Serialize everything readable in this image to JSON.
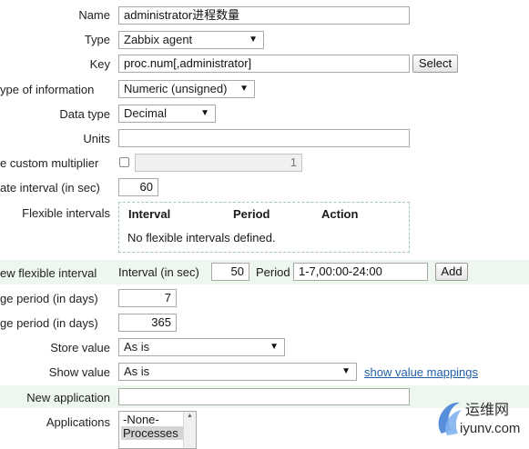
{
  "form": {
    "name": {
      "label": "Name",
      "value": "administrator进程数量"
    },
    "type": {
      "label": "Type",
      "value": "Zabbix agent"
    },
    "key": {
      "label": "Key",
      "value": "proc.num[,administrator]",
      "select_button": "Select"
    },
    "type_of_information": {
      "label": "ype of information",
      "value": "Numeric (unsigned)"
    },
    "data_type": {
      "label": "Data type",
      "value": "Decimal"
    },
    "units": {
      "label": "Units",
      "value": ""
    },
    "custom_multiplier": {
      "label": "e custom multiplier",
      "value": "1",
      "checked": false
    },
    "update_interval": {
      "label": "ate interval (in sec)",
      "value": "60"
    },
    "flexible_intervals": {
      "label": "Flexible intervals",
      "columns": [
        "Interval",
        "Period",
        "Action"
      ],
      "empty_text": "No flexible intervals defined."
    },
    "new_flexible_interval": {
      "label": "ew flexible interval",
      "interval_label": "Interval (in sec)",
      "interval_value": "50",
      "period_label": "Period",
      "period_value": "1-7,00:00-24:00",
      "add_button": "Add"
    },
    "history": {
      "label": "ge period (in days)",
      "value": "7"
    },
    "trends": {
      "label": "ge period (in days)",
      "value": "365"
    },
    "store_value": {
      "label": "Store value",
      "value": "As is"
    },
    "show_value": {
      "label": "Show value",
      "value": "As is",
      "link": "show value mappings"
    },
    "new_application": {
      "label": "New application",
      "value": ""
    },
    "applications": {
      "label": "Applications",
      "options": [
        "-None-",
        "Processes"
      ],
      "selected": "Processes"
    }
  },
  "watermark": {
    "text_cn": "运维网",
    "text_url": "iyunv.com",
    "colors": {
      "swirl": "#3a7bd5",
      "text": "#2b2b2b"
    }
  },
  "icons": {
    "select_caret": "triangle-down",
    "scroll_up": "triangle-up"
  }
}
